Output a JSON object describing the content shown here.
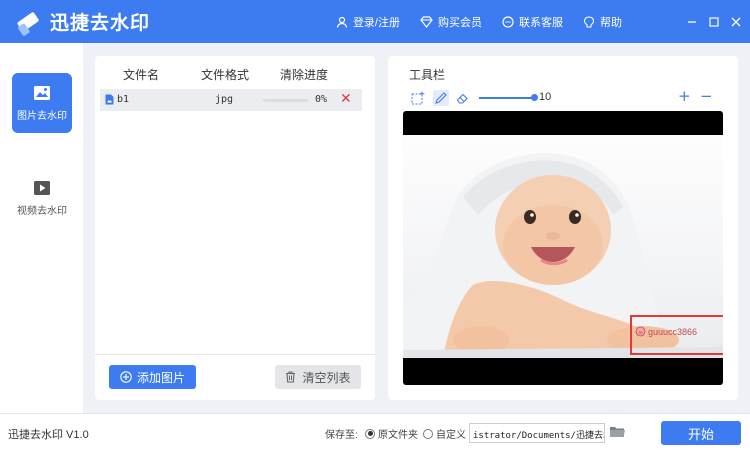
{
  "app": {
    "title": "迅捷去水印",
    "version_label": "迅捷去水印 V1.0"
  },
  "header": {
    "actions": [
      {
        "icon": "user-icon",
        "label": "登录/注册"
      },
      {
        "icon": "diamond-icon",
        "label": "购买会员"
      },
      {
        "icon": "chat-icon",
        "label": "联系客服"
      },
      {
        "icon": "help-icon",
        "label": "帮助"
      }
    ],
    "window_controls": [
      "minimize-icon",
      "maximize-icon",
      "close-icon"
    ]
  },
  "sidebar": {
    "items": [
      {
        "label": "图片去水印",
        "icon": "image-icon",
        "active": true
      },
      {
        "label": "视频去水印",
        "icon": "video-icon",
        "active": false
      }
    ]
  },
  "file_list": {
    "columns": [
      "文件名",
      "文件格式",
      "清除进度"
    ],
    "rows": [
      {
        "name": "b1",
        "format": "jpg",
        "progress": 0,
        "progress_label": "0%"
      }
    ],
    "add_button": "添加图片",
    "clear_button": "清空列表"
  },
  "toolbar": {
    "title": "工具栏",
    "tools": [
      "rect-select-icon",
      "brush-icon",
      "eraser-icon"
    ],
    "brush_size": "10",
    "zoom_in": "+",
    "zoom_out": "−"
  },
  "preview": {
    "watermark_text": "guuucc3866"
  },
  "bottom": {
    "save_to_label": "保存至:",
    "options": [
      {
        "label": "原文件夹",
        "checked": true
      },
      {
        "label": "自定义",
        "checked": false
      }
    ],
    "path_value": "istrator/Documents/迅捷去水印",
    "start_button": "开始"
  },
  "colors": {
    "accent": "#3c7cf0",
    "delete": "#e03b3b",
    "watermark_box": "#e53935"
  }
}
